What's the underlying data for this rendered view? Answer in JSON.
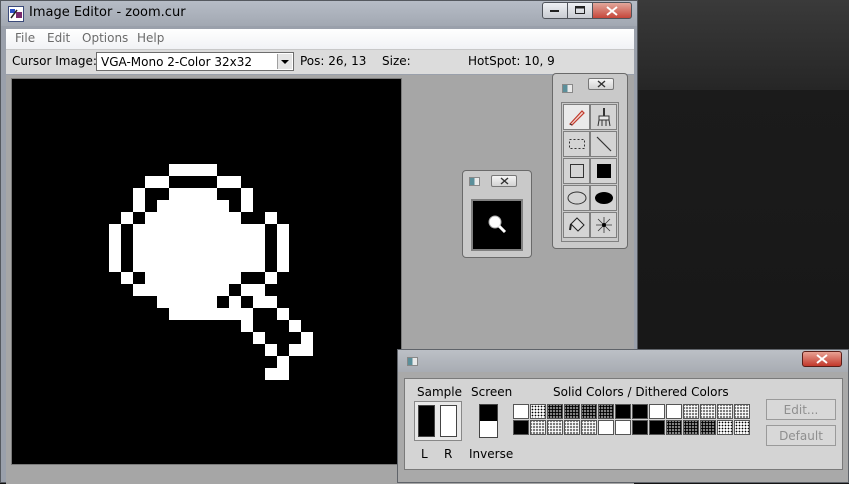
{
  "window": {
    "title": "Image Editor - zoom.cur"
  },
  "menu": {
    "items": [
      "File",
      "Edit",
      "Options",
      "Help"
    ]
  },
  "toolbar": {
    "cursor_image_label": "Cursor Image:",
    "cursor_image_value": "VGA-Mono 2-Color 32x32",
    "pos": "Pos: 26, 13",
    "size": "Size:",
    "hotspot": "HotSpot: 10, 9"
  },
  "tools": [
    "pencil",
    "brush",
    "selection",
    "line",
    "rectangle-outline",
    "rectangle-filled",
    "ellipse-outline",
    "ellipse-filled",
    "paint-bucket",
    "hotspot"
  ],
  "palette": {
    "sample_label": "Sample",
    "screen_label": "Screen",
    "colors_label": "Solid Colors / Dithered Colors",
    "left_label": "L",
    "right_label": "R",
    "inverse_label": "Inverse",
    "edit_button": "Edit...",
    "default_button": "Default"
  },
  "colors": {
    "canvas_bg": "#000000",
    "cursor_fg": "#ffffff",
    "desktop": "#2d2d2d"
  }
}
